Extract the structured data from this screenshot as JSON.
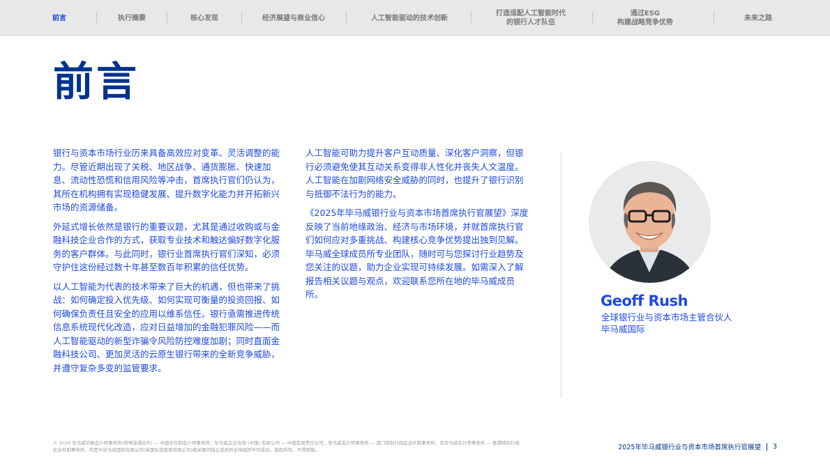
{
  "nav": {
    "items": [
      {
        "label": "前言"
      },
      {
        "label": "执行摘要"
      },
      {
        "label": "核心发现"
      },
      {
        "label": "经济展望与商业信心"
      },
      {
        "label": "人工智能驱动的技术创新"
      },
      {
        "label": "打造适配人工智能时代\n的银行人才队伍"
      },
      {
        "label": "通过ESG\n构建战略竞争优势"
      },
      {
        "label": "未来之路"
      }
    ],
    "active_index": 0
  },
  "page": {
    "title": "前言"
  },
  "body": {
    "col1": [
      "银行与资本市场行业历来具备高效应对变革、灵活调整的能力。尽管近期出现了关税、地区战争、通货膨胀、快速加息、流动性恐慌和信用风险等冲击，首席执行官们仍认为，其所在机构拥有实现稳健发展、提升数字化能力并开拓新兴市场的资源储备。",
      "外延式增长依然是银行的重要议题，尤其是通过收购或与金融科技企业合作的方式，获取专业技术和触达偏好数字化服务的客户群体。与此同时，银行业首席执行官们深知，必须守护住这份经过数十年甚至数百年积累的信任优势。",
      "以人工智能为代表的技术带来了巨大的机遇，但也带来了挑战：如何确定投入优先级、如何实现可衡量的投资回报、如何确保负责任且安全的应用以维系信任。银行亟需推进传统信息系统现代化改造，应对日益增加的金融犯罪风险——而人工智能驱动的新型诈骗令风险防控难度加剧；同时直面金融科技公司、更加灵活的云原生银行带来的全新竞争威胁，并遵守复杂多变的监管要求。"
    ],
    "col2": [
      "人工智能可助力提升客户互动质量、深化客户洞察，但银行必须避免使其互动关系变得非人性化并丧失人文温度。人工智能在加剧网络安全威胁的同时，也提升了银行识别与抵御不法行为的能力。",
      "《2025年毕马威银行业与资本市场首席执行官展望》深度反映了当前地缘政治、经济与市场环境，并就首席执行官们如何应对多重挑战、构建核心竞争优势提出独到见解。毕马威全球成员所专业团队，随时可与您探讨行业趋势及您关注的议题，助力企业实现可持续发展。如需深入了解报告相关议题与观点，欢迎联系您所在地的毕马威成员所。"
    ]
  },
  "person": {
    "name": "Geoff Rush",
    "role": "全球银行业与资本市场主管合伙人",
    "org": "毕马威国际"
  },
  "footer": {
    "legal": "© 2026 毕马威华振会计师事务所(特殊普通合伙) — 中国合伙制会计师事务所，毕马威企业咨询 (中国) 有限公司 — 中国有限责任公司，毕马威会计师事务所 — 澳门特别行政区合伙制事务所，及毕马威会计师事务所 — 香港特别行政区合伙制事务所，均是与毕马威国际有限公司(英国私营担保有限公司)相关联的独立成员所全球组织中的成员。版权所有，不得转载。",
    "report_title": "2025年毕马威银行业与资本市场首席执行官展望",
    "page_number": "3"
  },
  "colors": {
    "kpmg_dark_blue": "#00338d",
    "kpmg_blue": "#1e49e2",
    "nav_bg": "#e8e8e8"
  }
}
